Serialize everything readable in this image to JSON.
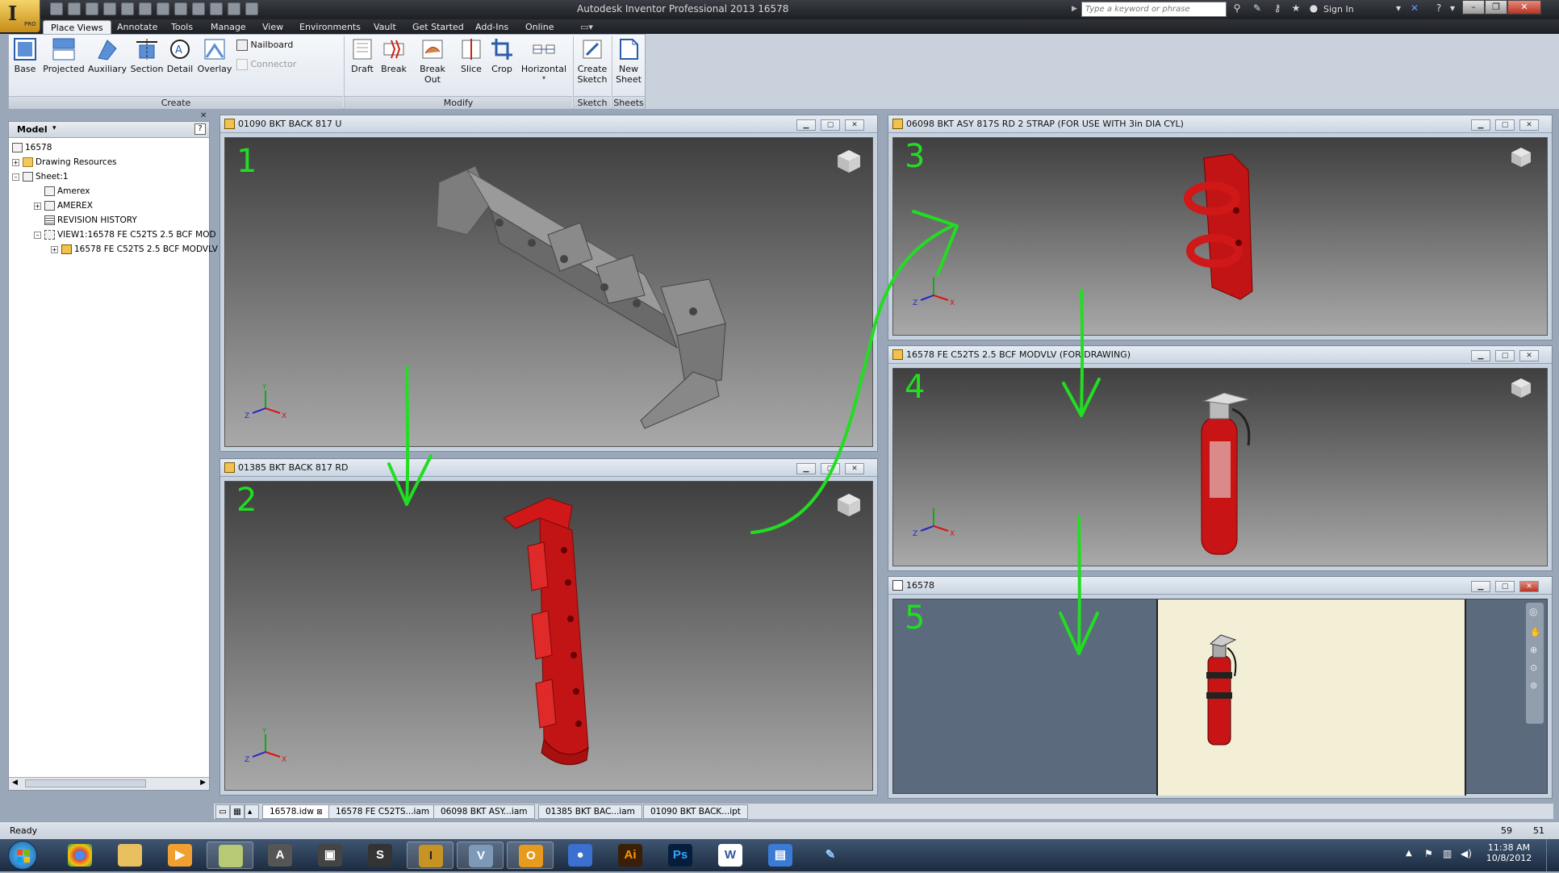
{
  "window": {
    "title": "Autodesk Inventor Professional 2013    16578",
    "search_placeholder": "Type a keyword or phrase",
    "sign_in": "Sign In",
    "app_badge": "PRO"
  },
  "ribbon_tabs": [
    "Place Views",
    "Annotate",
    "Tools",
    "Manage",
    "View",
    "Environments",
    "Vault",
    "Get Started",
    "Add-Ins",
    "Online"
  ],
  "ribbon": {
    "create": {
      "label": "Create",
      "buttons": [
        "Base",
        "Projected",
        "Auxiliary",
        "Section",
        "Detail",
        "Overlay"
      ],
      "small": [
        "Nailboard",
        "Connector"
      ]
    },
    "modify": {
      "label": "Modify",
      "buttons": [
        "Draft",
        "Break",
        "Break Out",
        "Slice",
        "Crop",
        "Horizontal"
      ]
    },
    "sketch": {
      "label": "Sketch",
      "button_line1": "Create",
      "button_line2": "Sketch"
    },
    "sheets": {
      "label": "Sheets",
      "button": "New Sheet"
    }
  },
  "browser": {
    "title": "Model",
    "items": [
      "16578",
      "Drawing Resources",
      "Sheet:1",
      "Amerex",
      "AMEREX",
      "REVISION HISTORY",
      "VIEW1:16578 FE C52TS 2.5 BCF MOD",
      "16578 FE C52TS 2.5 BCF MODVLV"
    ]
  },
  "documents": [
    {
      "title": "01090 BKT BACK 817 U",
      "number": "1"
    },
    {
      "title": "01385 BKT BACK 817 RD",
      "number": "2"
    },
    {
      "title": "06098 BKT ASY 817S RD 2 STRAP (FOR USE WITH 3in DIA CYL)",
      "number": "3"
    },
    {
      "title": "16578 FE C52TS 2.5 BCF MODVLV (FOR DRAWING)",
      "number": "4"
    },
    {
      "title": "16578",
      "number": "5"
    }
  ],
  "doc_tabs": [
    "16578.idw",
    "16578 FE C52TS...iam",
    "06098 BKT ASY...iam",
    "01385 BKT BAC...iam",
    "01090 BKT BACK...ipt"
  ],
  "status": {
    "text": "Ready",
    "n1": "59",
    "n2": "51"
  },
  "clock": {
    "time": "11:38 AM",
    "date": "10/8/2012"
  },
  "taskbar_apps": [
    "Ai",
    "Ps",
    "W"
  ],
  "colors": {
    "annotation_green": "#22dd22",
    "part_red": "#d01818",
    "part_gray": "#8e8e8e"
  }
}
